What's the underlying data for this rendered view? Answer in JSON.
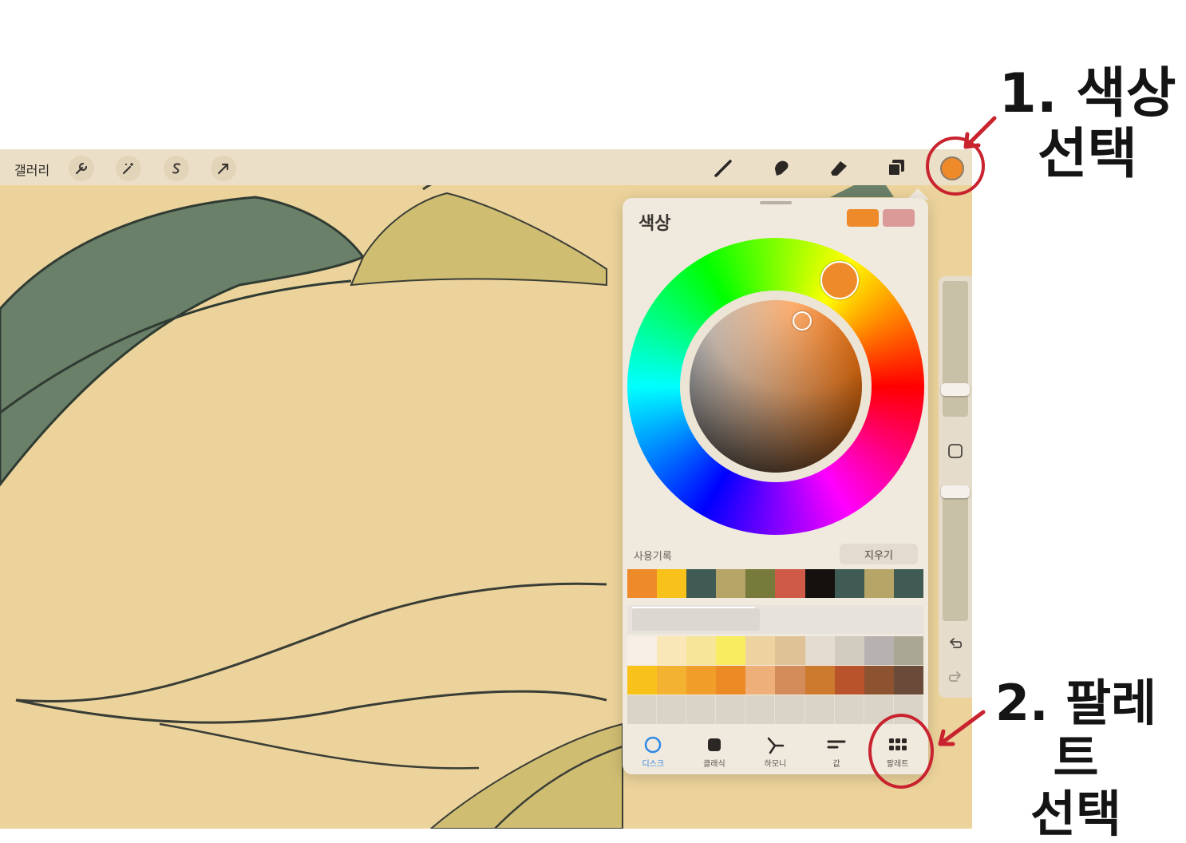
{
  "toolbar": {
    "gallery_label": "갤러리",
    "left_icons": [
      "wrench-icon",
      "magic-wand-icon",
      "selection-icon",
      "transform-arrow-icon"
    ],
    "right_icons": [
      "brush-icon",
      "smudge-icon",
      "eraser-icon",
      "layers-icon"
    ],
    "current_color": "#ee8a2a"
  },
  "color_panel": {
    "title": "색상",
    "primary_color": "#ee8a2a",
    "secondary_color": "#d99a98",
    "history_label": "사용기록",
    "clear_label": "지우기",
    "history_colors": [
      "#ee8a2a",
      "#f8c21b",
      "#3f5b54",
      "#b6a566",
      "#767a3a",
      "#d05a48",
      "#15110e",
      "#3f5b54",
      "#b6a566",
      "#3f5b54"
    ],
    "palette_rows": [
      [
        "#f7efe5",
        "#fae7b8",
        "#f7e59a",
        "#f8ec61",
        "#ecd3a0",
        "#dfc396",
        "#e3dccf",
        "#d2cbc0",
        "#b7b2b1",
        "#aaa794"
      ],
      [
        "#f8c21b",
        "#f4b232",
        "#f19d2a",
        "#ec8a26",
        "#efaf78",
        "#d48b5a",
        "#cd7a2f",
        "#b8532c",
        "#8d5330",
        "#6a4a38"
      ]
    ],
    "tabs": [
      {
        "label": "디스크",
        "icon": "disc-icon",
        "active": true
      },
      {
        "label": "클래식",
        "icon": "classic-square-icon",
        "active": false
      },
      {
        "label": "하모니",
        "icon": "harmony-icon",
        "active": false
      },
      {
        "label": "값",
        "icon": "value-sliders-icon",
        "active": false
      },
      {
        "label": "팔레트",
        "icon": "palette-grid-icon",
        "active": false
      }
    ]
  },
  "annotations": {
    "step1_line1": "1. 색상",
    "step1_line2": "선택",
    "step2_line1": "2. 팔레트",
    "step2_line2": "선택",
    "highlight_color": "#c8232e"
  }
}
